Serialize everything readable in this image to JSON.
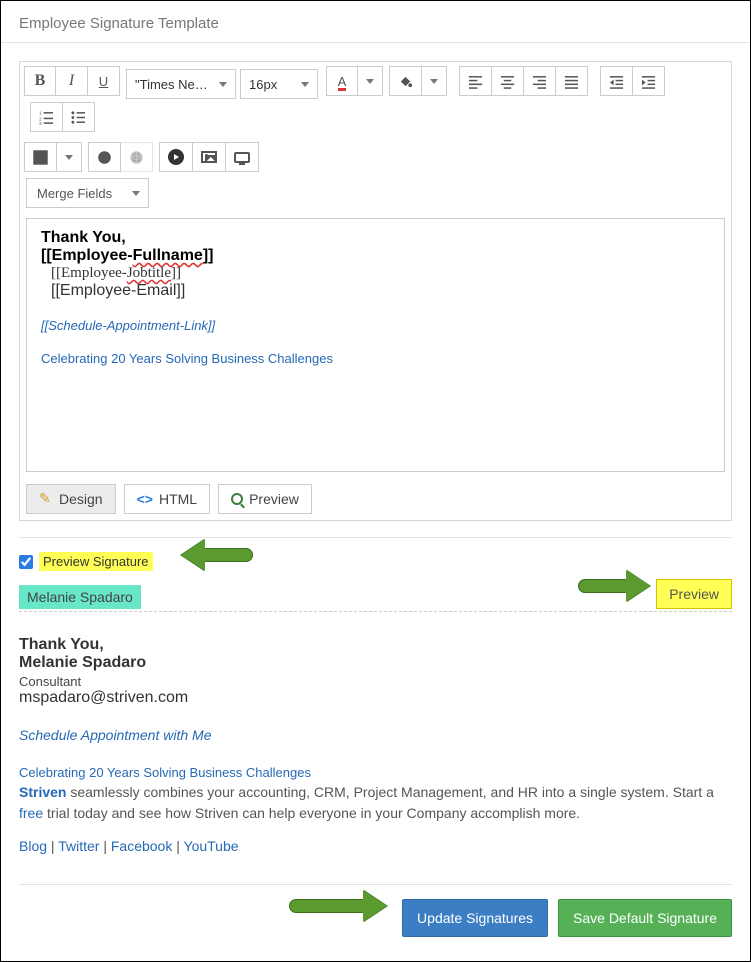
{
  "header": {
    "title": "Employee Signature Template"
  },
  "toolbar": {
    "font_family": "\"Times Ne…",
    "font_size": "16px",
    "font_color_label": "A",
    "merge_fields": "Merge Fields"
  },
  "editor": {
    "thank_you": "Thank You,",
    "fullname_left": "[[Employee-",
    "fullname_spell": "Fullname",
    "fullname_right": "]]",
    "jobtitle_left": "[[Employee-",
    "jobtitle_spell": "Jobtitle",
    "jobtitle_right": "]]",
    "email": "[[Employee-Email]]",
    "schedule_link": "[[Schedule-Appointment-Link]]",
    "tagline": "Celebrating 20 Years Solving Business Challenges"
  },
  "tabs": {
    "design": "Design",
    "html": "HTML",
    "preview": "Preview"
  },
  "preview_section": {
    "checkbox_label": "Preview Signature",
    "employee": "Melanie Spadaro",
    "preview_button": "Preview"
  },
  "signature": {
    "thank_you": "Thank You,",
    "name": "Melanie Spadaro",
    "jobtitle": "Consultant",
    "email": "mspadaro@striven.com",
    "schedule": "Schedule Appointment with Me",
    "tagline": "Celebrating 20 Years Solving Business Challenges",
    "body_before_striven": "",
    "striven": "Striven",
    "body_mid": " seamlessly combines your accounting, CRM, Project Management, and HR into a single system. Start a ",
    "free": "free",
    "body_after": " trial today and see how Striven can help everyone in your Company accomplish more.",
    "links": {
      "blog": "Blog",
      "twitter": "Twitter",
      "facebook": "Facebook",
      "youtube": "YouTube"
    }
  },
  "footer": {
    "update": "Update Signatures",
    "save": "Save Default Signature"
  }
}
